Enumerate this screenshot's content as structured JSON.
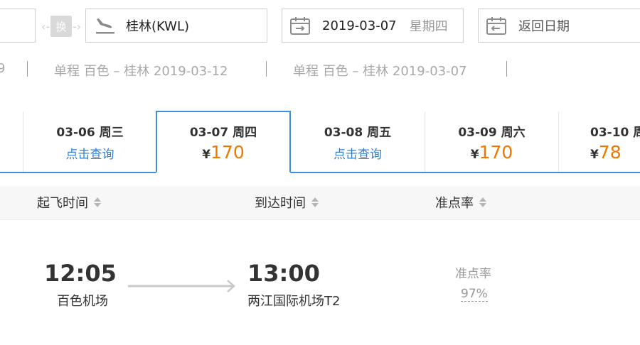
{
  "search": {
    "to_city": "桂林(KWL)",
    "swap_label": "换",
    "depart_date": "2019-03-07",
    "depart_weekday": "星期四",
    "return_placeholder": "返回日期"
  },
  "history": [
    {
      "label": "9"
    },
    {
      "label": "单程 百色 – 桂林 2019-03-12"
    },
    {
      "label": "单程 百色 – 桂林 2019-03-07"
    }
  ],
  "date_tabs": [
    {
      "date": "03-06 周三",
      "query": "点击查询"
    },
    {
      "date": "03-07 周四",
      "currency": "¥",
      "price": "170"
    },
    {
      "date": "03-08 周五",
      "query": "点击查询"
    },
    {
      "date": "03-09 周六",
      "currency": "¥",
      "price": "170"
    },
    {
      "date": "03-10 周",
      "currency": "¥",
      "price": "78"
    }
  ],
  "columns": {
    "depart_time": "起飞时间",
    "arrive_time": "到达时间",
    "ontime": "准点率"
  },
  "flight": {
    "depart_time": "12:05",
    "depart_airport": "百色机场",
    "arrive_time": "13:00",
    "arrive_airport": "两江国际机场T2",
    "ontime_label": "准点率",
    "ontime_value": "97%"
  },
  "colors": {
    "accent_blue": "#3d8fe0",
    "price_orange": "#f07700",
    "link_blue": "#2f7fd6"
  }
}
